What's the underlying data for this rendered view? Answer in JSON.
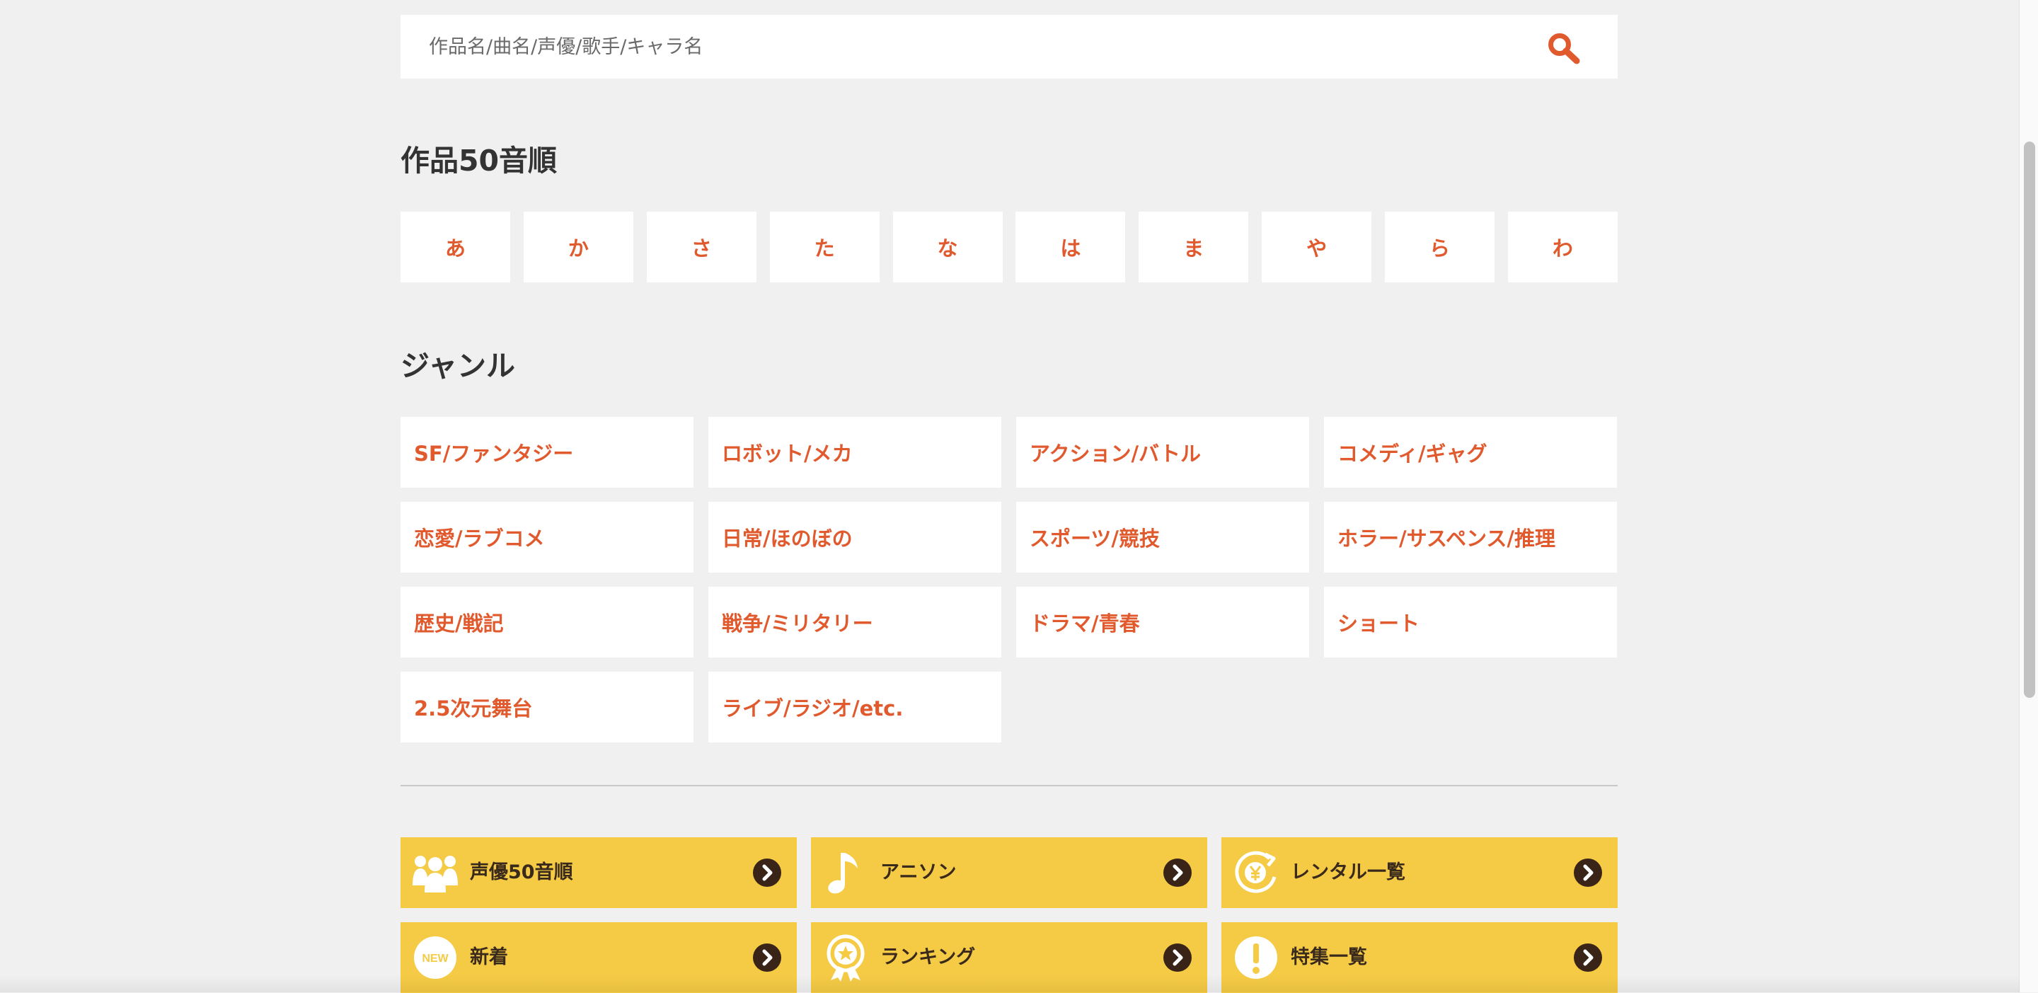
{
  "search": {
    "placeholder": "作品名/曲名/声優/歌手/キャラ名",
    "icon": "search-icon"
  },
  "kana_section": {
    "title": "作品50音順",
    "items": [
      "あ",
      "か",
      "さ",
      "た",
      "な",
      "は",
      "ま",
      "や",
      "ら",
      "わ"
    ]
  },
  "genre_section": {
    "title": "ジャンル",
    "items": [
      "SF/ファンタジー",
      "ロボット/メカ",
      "アクション/バトル",
      "コメディ/ギャグ",
      "恋愛/ラブコメ",
      "日常/ほのぼの",
      "スポーツ/競技",
      "ホラー/サスペンス/推理",
      "歴史/戦記",
      "戦争/ミリタリー",
      "ドラマ/青春",
      "ショート",
      "2.5次元舞台",
      "ライブ/ラジオ/etc."
    ]
  },
  "features": {
    "items": [
      {
        "label": "声優50音順",
        "icon": "voice-actors-icon"
      },
      {
        "label": "アニソン",
        "icon": "music-note-icon"
      },
      {
        "label": "レンタル一覧",
        "icon": "rental-yen-icon"
      },
      {
        "label": "新着",
        "icon": "new-badge-icon",
        "badge_text": "NEW"
      },
      {
        "label": "ランキング",
        "icon": "ranking-medal-icon"
      },
      {
        "label": "特集一覧",
        "icon": "exclamation-icon"
      }
    ]
  },
  "colors": {
    "background": "#f0f0f0",
    "accent_text": "#e05a2e",
    "feature_bg": "#f5cb45",
    "feature_text": "#3a2a1c",
    "arrow_bg": "#3a2418"
  }
}
